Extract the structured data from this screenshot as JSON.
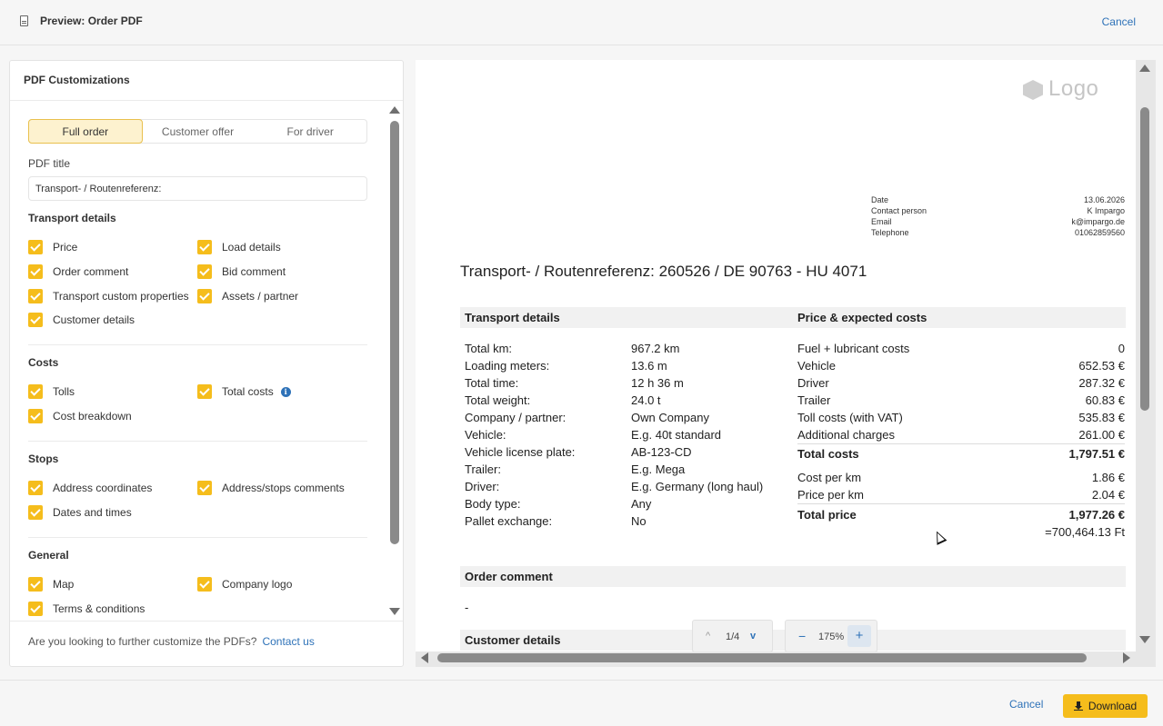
{
  "header": {
    "title": "Preview: Order PDF",
    "cancel_label": "Cancel"
  },
  "left_panel": {
    "title": "PDF Customizations",
    "tabs": [
      {
        "label": "Full order",
        "active": true
      },
      {
        "label": "Customer offer",
        "active": false
      },
      {
        "label": "For driver",
        "active": false
      }
    ],
    "pdf_title_label": "PDF title",
    "pdf_title_value": "Transport- / Routenreferenz:",
    "sections": {
      "transport": {
        "heading": "Transport details",
        "items": [
          "Price",
          "Load details",
          "Order comment",
          "Bid comment",
          "Transport custom properties",
          "Assets / partner",
          "Customer details"
        ]
      },
      "costs": {
        "heading": "Costs",
        "items": [
          "Tolls",
          "Total costs",
          "Cost breakdown"
        ]
      },
      "stops": {
        "heading": "Stops",
        "items": [
          "Address coordinates",
          "Address/stops comments",
          "Dates and times"
        ]
      },
      "general": {
        "heading": "General",
        "items": [
          "Map",
          "Company logo",
          "Terms & conditions"
        ]
      }
    },
    "info_icon": "i",
    "footer_text": "Are you looking to further customize the PDFs?",
    "footer_link": "Contact us"
  },
  "preview": {
    "logo_text": "Logo",
    "meta": [
      {
        "label": "Date",
        "value": "13.06.2026"
      },
      {
        "label": "Contact person",
        "value": "K Impargo"
      },
      {
        "label": "Email",
        "value": "k@impargo.de"
      },
      {
        "label": "Telephone",
        "value": "01062859560"
      }
    ],
    "doc_title": "Transport- / Routenreferenz: 260526 / DE 90763 - HU 4071",
    "transport_heading": "Transport details",
    "transport_rows": [
      {
        "label": "Total km:",
        "value": "967.2 km"
      },
      {
        "label": "Loading meters:",
        "value": "13.6 m"
      },
      {
        "label": "Total time:",
        "value": "12 h 36 m"
      },
      {
        "label": "Total weight:",
        "value": "24.0 t"
      },
      {
        "label": "Company / partner:",
        "value": "Own Company"
      },
      {
        "label": "Vehicle:",
        "value": "E.g. 40t standard"
      },
      {
        "label": "Vehicle license plate:",
        "value": "AB-123-CD"
      },
      {
        "label": "Trailer:",
        "value": "E.g. Mega"
      },
      {
        "label": "Driver:",
        "value": "E.g. Germany (long haul)"
      },
      {
        "label": "Body type:",
        "value": "Any"
      },
      {
        "label": "Pallet exchange:",
        "value": "No"
      }
    ],
    "price_heading": "Price & expected costs",
    "price_rows": [
      {
        "label": "Fuel + lubricant costs",
        "value": "0"
      },
      {
        "label": "Vehicle",
        "value": "652.53 €"
      },
      {
        "label": "Driver",
        "value": "287.32 €"
      },
      {
        "label": "Trailer",
        "value": "60.83 €"
      },
      {
        "label": "Toll costs (with VAT)",
        "value": "535.83 €"
      },
      {
        "label": "Additional charges",
        "value": "261.00 €"
      }
    ],
    "total_costs_label": "Total costs",
    "total_costs_value": "1,797.51 €",
    "cost_per_km_label": "Cost per km",
    "cost_per_km_value": "1.86 €",
    "price_per_km_label": "Price per km",
    "price_per_km_value": "2.04 €",
    "total_price_label": "Total price",
    "total_price_value": "1,977.26 €",
    "total_price_huf": "=700,464.13 Ft",
    "order_comment_heading": "Order comment",
    "order_comment_value": "-",
    "customer_details_heading": "Customer details",
    "pager": {
      "page": "1/4",
      "up_icon": "^",
      "down_icon": "v"
    },
    "zoom": {
      "value": "175%",
      "minus": "−",
      "plus": "+"
    }
  },
  "footer": {
    "cancel_label": "Cancel",
    "download_label": "Download"
  },
  "colors": {
    "accent": "#f5bd1c",
    "link": "#2e72b8",
    "active_tab_bg": "#fdf2cf"
  }
}
